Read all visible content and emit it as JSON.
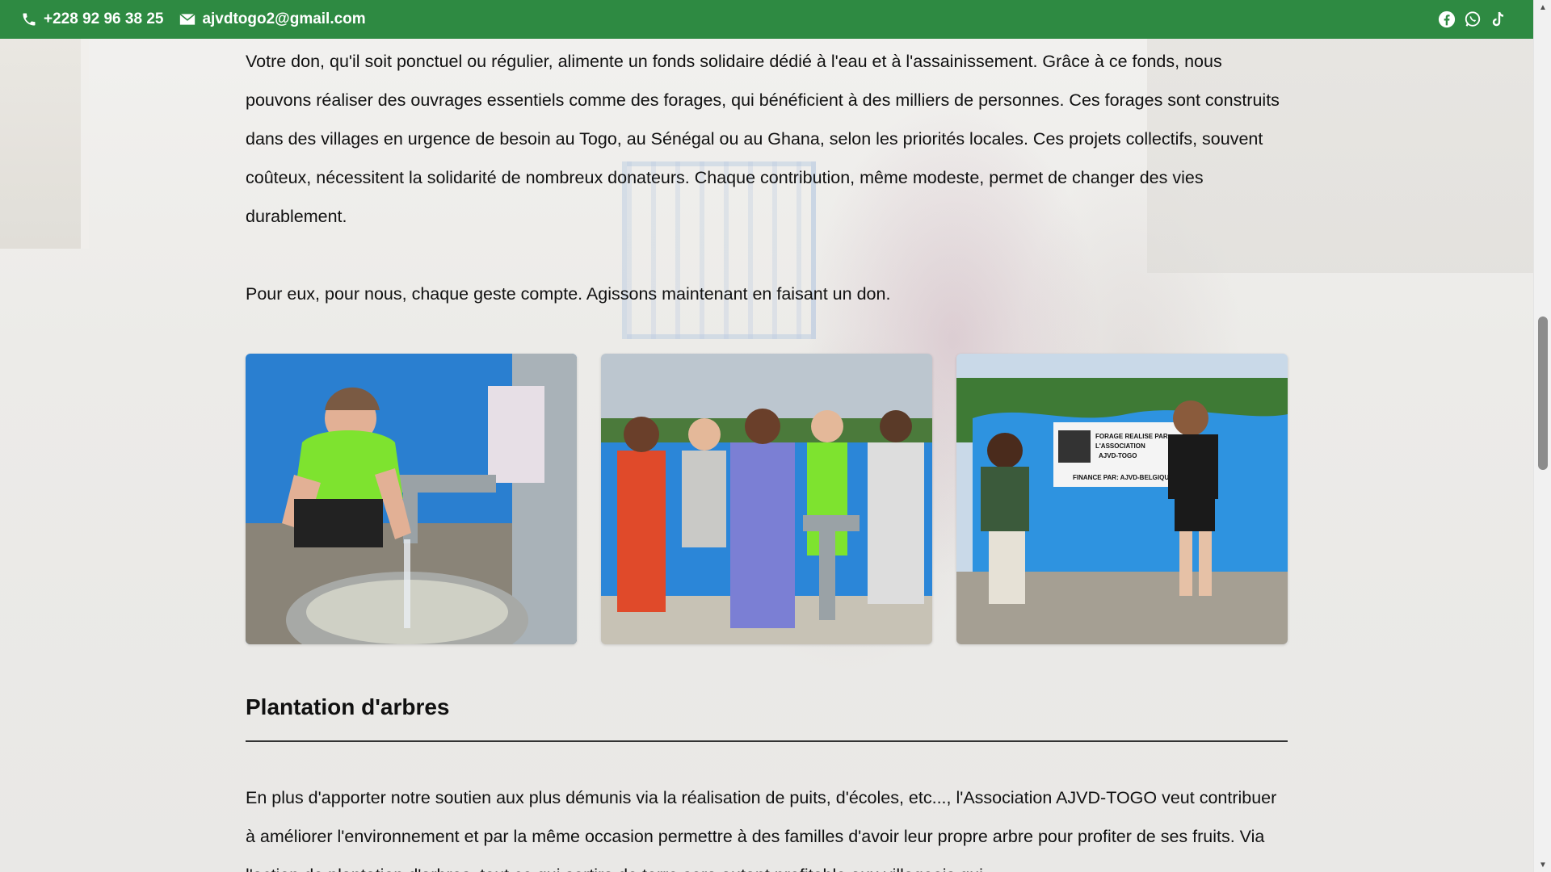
{
  "topbar": {
    "phone": "+228 92 96 38 25",
    "email": "ajvdtogo2@gmail.com",
    "social": [
      "facebook-icon",
      "whatsapp-icon",
      "tiktok-icon"
    ],
    "color": "#2e8a42"
  },
  "main": {
    "paragraph1": "Votre don, qu'il soit ponctuel ou régulier, alimente un fonds solidaire dédié à l'eau et à l'assainissement. Grâce à ce fonds, nous pouvons réaliser des ouvrages essentiels comme des forages, qui bénéficient à des milliers de personnes. Ces forages sont construits dans des villages en urgence de besoin au Togo, au Sénégal ou au Ghana, selon les priorités locales. Ces projets collectifs, souvent coûteux, nécessitent la solidarité de nombreux donateurs. Chaque contribution, même modeste, permet de changer des vies durablement.",
    "paragraph2": "Pour eux, pour nous, chaque geste compte. Agissons maintenant en faisant un don.",
    "gallery": [
      {
        "name": "photo-woman-drinking-water"
      },
      {
        "name": "photo-group-celebrating-pump"
      },
      {
        "name": "photo-sign-forage"
      }
    ],
    "sign": {
      "line1": "FORAGE REALISE PAR",
      "line2": "L'ASSOCIATION",
      "line3": "AJVD-TOGO",
      "line4": "FINANCE PAR: AJVD-BELGIQUE"
    },
    "section_title": "Plantation d'arbres",
    "paragraph3": "En plus d'apporter notre soutien aux plus démunis via la réalisation de puits, d'écoles, etc..., l'Association AJVD-TOGO veut contribuer à améliorer l'environnement et par la même occasion permettre à des familles d'avoir leur propre arbre pour profiter de ses fruits. Via l'action de plantation d'arbres, tout ce qui sortira de terre sera autant profitable aux villageois qui"
  }
}
